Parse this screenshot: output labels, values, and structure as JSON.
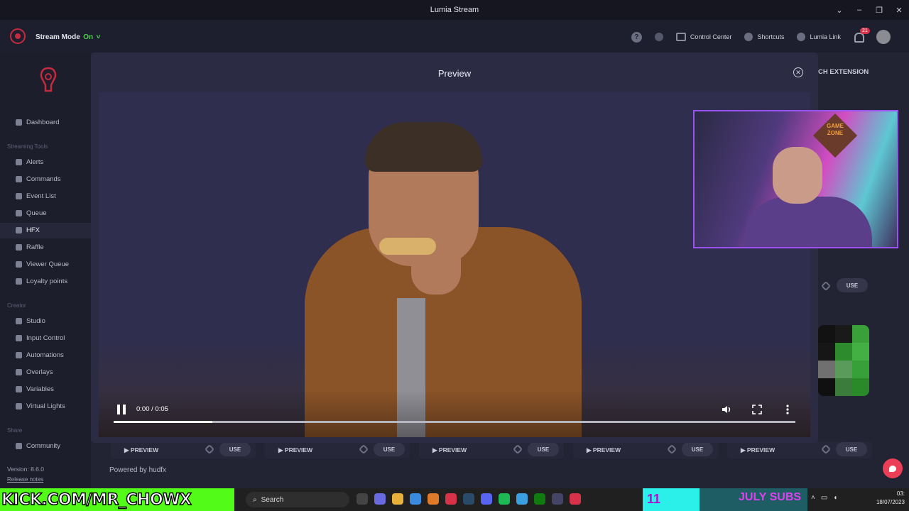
{
  "window": {
    "title": "Lumia Stream",
    "controls": [
      "⌄",
      "–",
      "❐",
      "✕"
    ]
  },
  "appbar": {
    "stream_mode_label": "Stream Mode",
    "stream_mode_state": "On",
    "stream_mode_suffix": "˅",
    "control_center": "Control Center",
    "shortcuts": "Shortcuts",
    "lumia_link": "Lumia Link",
    "notifications_count": "21",
    "help_glyph": "?"
  },
  "sidebar": {
    "items_top": [
      {
        "label": "Dashboard",
        "icon": "grid-icon"
      }
    ],
    "section_streaming": "Streaming Tools",
    "items_streaming": [
      {
        "label": "Alerts",
        "icon": "bell-icon"
      },
      {
        "label": "Commands",
        "icon": "chat-icon"
      },
      {
        "label": "Event List",
        "icon": "list-icon"
      },
      {
        "label": "Queue",
        "icon": "clock-icon"
      },
      {
        "label": "HFX",
        "icon": "monitor-icon",
        "active": true
      },
      {
        "label": "Raffle",
        "icon": "ticket-icon"
      },
      {
        "label": "Viewer Queue",
        "icon": "people-icon"
      },
      {
        "label": "Loyalty points",
        "icon": "coin-icon"
      }
    ],
    "section_creator": "Creator",
    "items_creator": [
      {
        "label": "Studio",
        "icon": "studio-icon"
      },
      {
        "label": "Input Control",
        "icon": "gamepad-icon"
      },
      {
        "label": "Automations",
        "icon": "automation-icon"
      },
      {
        "label": "Overlays",
        "icon": "layers-icon"
      },
      {
        "label": "Variables",
        "icon": "variable-icon"
      },
      {
        "label": "Virtual Lights",
        "icon": "light-icon"
      }
    ],
    "section_share": "Share",
    "items_share": [
      {
        "label": "Community",
        "icon": "community-icon"
      }
    ],
    "version": "Version: 8.6.0",
    "release_notes": "Release notes"
  },
  "background": {
    "extension_label": "CH EXTENSION",
    "preview_label": "▶ PREVIEW",
    "use_label": "USE",
    "powered_by": "Powered by hudfx"
  },
  "modal": {
    "title": "Preview",
    "close_glyph": "✕",
    "video": {
      "time": "0:00 / 0:05",
      "progress": 0.145
    }
  },
  "webcam": {
    "sign_text": "GAME ZONE"
  },
  "taskbar": {
    "kick_text": "KICK.COM/MR_CHOWX",
    "search_label": "Search",
    "subs_count": "11",
    "subs_label": "JULY SUBS",
    "clock_time": "03:",
    "clock_date": "18/07/2023"
  },
  "colors": {
    "accent_red": "#c52a3f",
    "stream_on_green": "#4cd34c",
    "kick_green": "#53fc18",
    "modal_bg": "#2b2c44"
  }
}
